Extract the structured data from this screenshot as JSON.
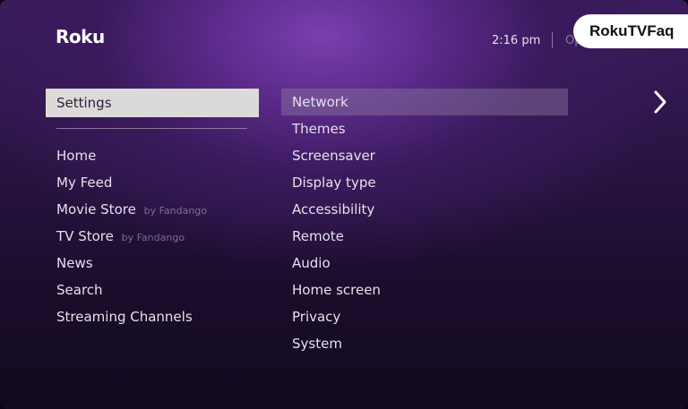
{
  "header": {
    "logo": "Roku",
    "time": "2:16  pm",
    "options_label": "Op"
  },
  "watermark": "RokuTVFaq",
  "left_menu": {
    "selected": "Settings",
    "items": [
      {
        "label": "Home",
        "by": ""
      },
      {
        "label": "My Feed",
        "by": ""
      },
      {
        "label": "Movie Store",
        "by": "by Fandango"
      },
      {
        "label": "TV Store",
        "by": "by Fandango"
      },
      {
        "label": "News",
        "by": ""
      },
      {
        "label": "Search",
        "by": ""
      },
      {
        "label": "Streaming Channels",
        "by": ""
      }
    ]
  },
  "right_menu": {
    "focused_index": 0,
    "items": [
      "Network",
      "Themes",
      "Screensaver",
      "Display type",
      "Accessibility",
      "Remote",
      "Audio",
      "Home screen",
      "Privacy",
      "System"
    ]
  },
  "icons": {
    "next": "chevron-right-icon"
  },
  "colors": {
    "selected_bg": "#dcdad8",
    "focus_bg": "#8c78a0",
    "text": "#e6e0ee",
    "accent_purple": "#7a3fae"
  }
}
